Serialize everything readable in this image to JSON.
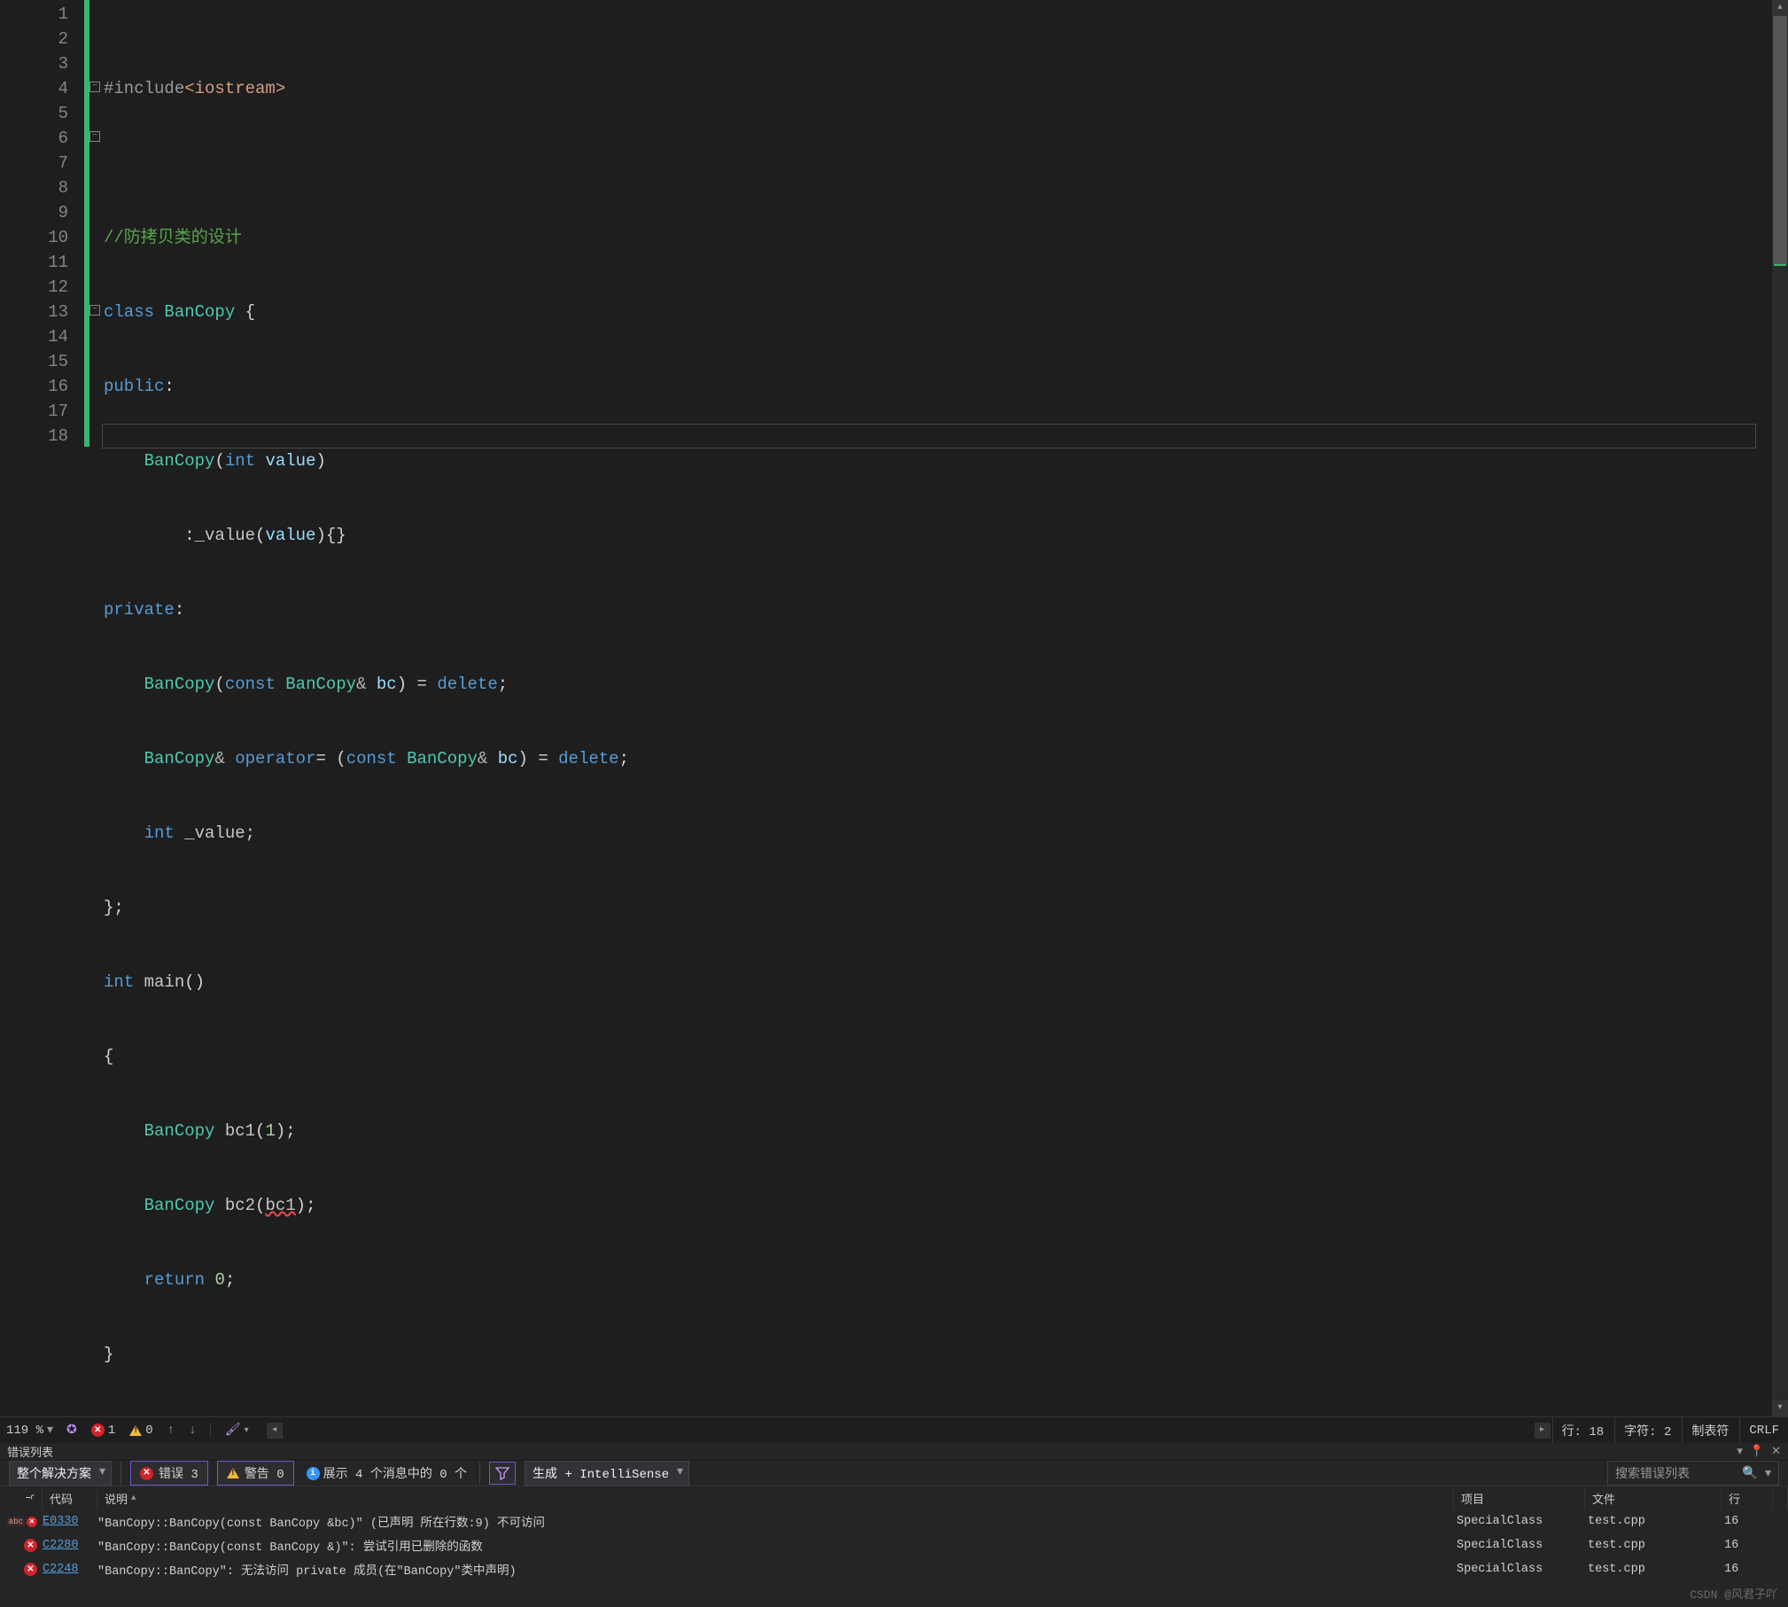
{
  "gutter": [
    "1",
    "2",
    "3",
    "4",
    "5",
    "6",
    "7",
    "8",
    "9",
    "10",
    "11",
    "12",
    "13",
    "14",
    "15",
    "16",
    "17",
    "18"
  ],
  "code": {
    "l1": {
      "a": "#include",
      "b": "<iostream>"
    },
    "l3": "//防拷贝类的设计",
    "l4": {
      "a": "class",
      "b": " BanCopy ",
      "c": "{"
    },
    "l5": {
      "a": "public",
      "b": ":"
    },
    "l6": {
      "a": "BanCopy",
      "b": "(",
      "c": "int",
      "d": " value",
      "e": ")"
    },
    "l7": {
      "a": ":",
      "b": "_value",
      "c": "(",
      "d": "value",
      "e": "){}"
    },
    "l8": {
      "a": "private",
      "b": ":"
    },
    "l9": {
      "a": "BanCopy",
      "b": "(",
      "c": "const",
      "d": " BanCopy",
      "e": "& ",
      "f": "bc",
      "g": ") = ",
      "h": "delete",
      "i": ";"
    },
    "l10": {
      "a": "BanCopy",
      "b": "& ",
      "c": "operator",
      "d": "= (",
      "e": "const",
      "f": " BanCopy",
      "g": "& ",
      "h": "bc",
      "i": ") = ",
      "j": "delete",
      "k": ";"
    },
    "l11": {
      "a": "int",
      "b": " _value;"
    },
    "l12": "};",
    "l13": {
      "a": "int",
      "b": " main",
      "c": "()"
    },
    "l14": "{",
    "l15": {
      "a": "BanCopy ",
      "b": "bc1",
      "c": "(",
      "d": "1",
      "e": ");"
    },
    "l16": {
      "a": "BanCopy ",
      "b": "bc2",
      "c": "(",
      "d": "bc1",
      "e": ");"
    },
    "l17": {
      "a": "return",
      "b": " ",
      "c": "0",
      "d": ";"
    },
    "l18": "}"
  },
  "statusbar": {
    "zoom": "119 %",
    "err_count": "1",
    "warn_count": "0",
    "ln": "行: 18",
    "ch": "字符: 2",
    "tabs": "制表符",
    "eol": "CRLF"
  },
  "panel": {
    "title": "错误列表",
    "scope": "整个解决方案",
    "errors_label": "错误 3",
    "warnings_label": "警告 0",
    "info_text": "展示 4 个消息中的 0 个",
    "source": "生成 + IntelliSense",
    "search_placeholder": "搜索错误列表"
  },
  "columns": {
    "code": "代码",
    "desc": "说明",
    "proj": "项目",
    "file": "文件",
    "line": "行"
  },
  "errors": [
    {
      "icon": "abc",
      "code": "E0330",
      "desc": "\"BanCopy::BanCopy(const BanCopy &bc)\" (已声明 所在行数:9) 不可访问",
      "proj": "SpecialClass",
      "file": "test.cpp",
      "line": "16"
    },
    {
      "icon": "err",
      "code": "C2280",
      "desc": "\"BanCopy::BanCopy(const BanCopy &)\": 尝试引用已删除的函数",
      "proj": "SpecialClass",
      "file": "test.cpp",
      "line": "16"
    },
    {
      "icon": "err",
      "code": "C2248",
      "desc": "\"BanCopy::BanCopy\": 无法访问 private 成员(在\"BanCopy\"类中声明)",
      "proj": "SpecialClass",
      "file": "test.cpp",
      "line": "16"
    }
  ],
  "watermark": "CSDN @风君子吖"
}
